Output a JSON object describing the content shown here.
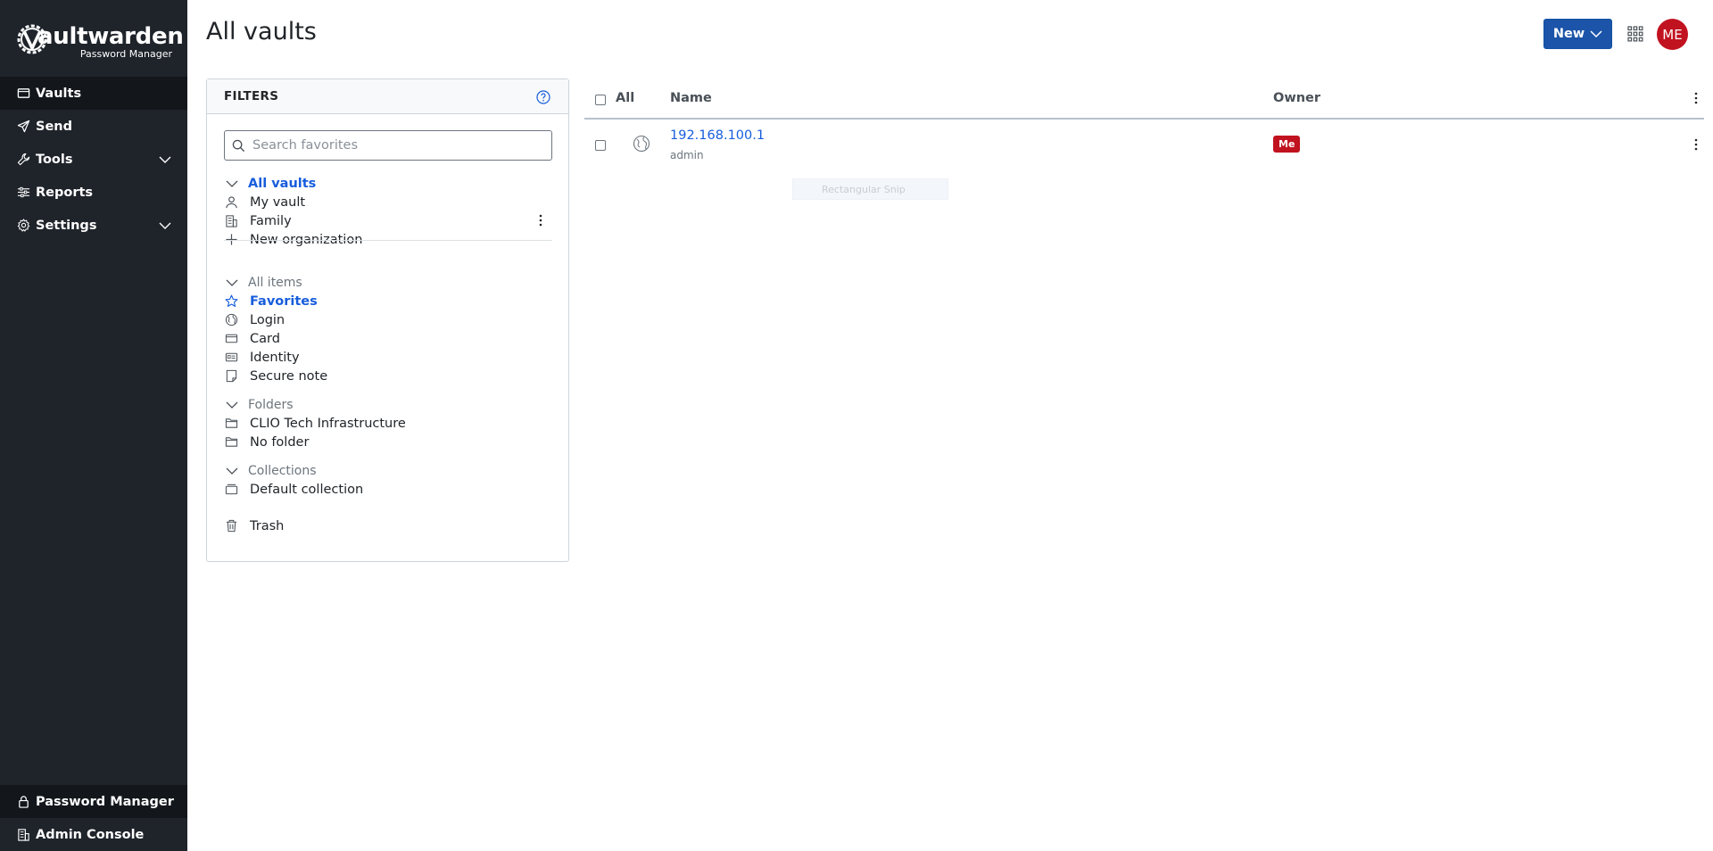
{
  "sidebar": {
    "logo": {
      "brand": "aultwarden",
      "subtitle": "Password Manager"
    },
    "items": [
      {
        "label": "Vaults",
        "icon": "vault-icon"
      },
      {
        "label": "Send",
        "icon": "send-icon"
      },
      {
        "label": "Tools",
        "icon": "wrench-icon"
      },
      {
        "label": "Reports",
        "icon": "sliders-icon"
      },
      {
        "label": "Settings",
        "icon": "gear-icon"
      }
    ],
    "bottom": [
      {
        "label": "Password Manager",
        "icon": "lock-icon"
      },
      {
        "label": "Admin Console",
        "icon": "business-icon"
      }
    ]
  },
  "header": {
    "title": "All vaults",
    "new_label": "New",
    "avatar_initials": "ME"
  },
  "filters": {
    "title": "FILTERS",
    "search_placeholder": "Search favorites",
    "vaults": {
      "head": "All vaults",
      "items": [
        "My vault",
        "Family",
        "New organization"
      ]
    },
    "types": {
      "head": "All items",
      "items": [
        "Favorites",
        "Login",
        "Card",
        "Identity",
        "Secure note"
      ]
    },
    "folders": {
      "head": "Folders",
      "items": [
        "CLIO Tech Infrastructure",
        "No folder"
      ]
    },
    "collections": {
      "head": "Collections",
      "items": [
        "Default collection"
      ]
    },
    "trash": "Trash"
  },
  "table": {
    "columns": {
      "all": "All",
      "name": "Name",
      "owner": "Owner"
    },
    "rows": [
      {
        "name": "192.168.100.1",
        "subtitle": "admin",
        "owner": "Me"
      }
    ]
  },
  "overlay": {
    "snip_label": "Rectangular Snip"
  },
  "colors": {
    "sidebar_bg": "#1f242b",
    "accent": "#175ddc",
    "owner_badge": "#c1121f",
    "avatar": "#c1121f"
  }
}
